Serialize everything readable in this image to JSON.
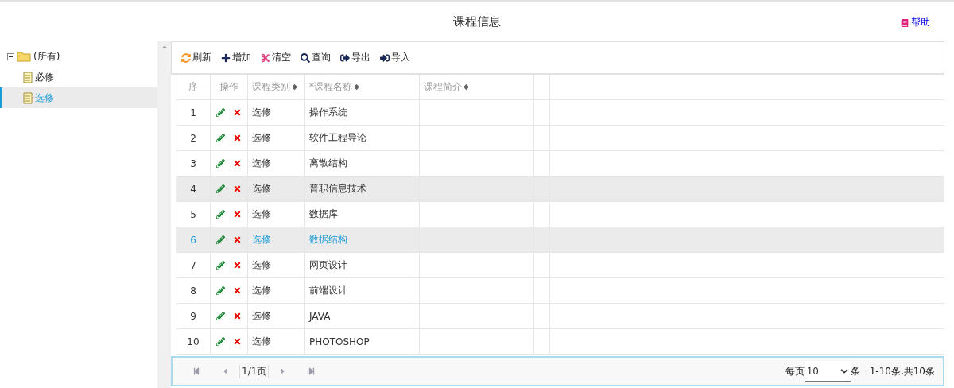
{
  "header": {
    "title": "课程信息",
    "help": "帮助"
  },
  "tree": [
    {
      "label": "(所有)",
      "kind": "folder",
      "expanded": true,
      "selected": false,
      "children": [
        {
          "label": "必修",
          "kind": "doc",
          "selected": false
        },
        {
          "label": "选修",
          "kind": "doc",
          "selected": true
        }
      ]
    }
  ],
  "toolbar": [
    {
      "label": "刷新"
    },
    {
      "label": "增加"
    },
    {
      "label": "清空"
    },
    {
      "label": "查询"
    },
    {
      "label": "导出"
    },
    {
      "label": "导入"
    }
  ],
  "table": {
    "columns": [
      {
        "label": "序",
        "sortable": false
      },
      {
        "label": "操作",
        "sortable": false
      },
      {
        "label": "课程类别",
        "sortable": true
      },
      {
        "label": "*课程名称",
        "sortable": true
      },
      {
        "label": "课程简介",
        "sortable": true
      }
    ],
    "rows": [
      {
        "index": "1",
        "category": "选修",
        "name": "操作系统",
        "hovered": false,
        "selected": false
      },
      {
        "index": "2",
        "category": "选修",
        "name": "软件工程导论",
        "hovered": false,
        "selected": false
      },
      {
        "index": "3",
        "category": "选修",
        "name": "离散结构",
        "hovered": false,
        "selected": false
      },
      {
        "index": "4",
        "category": "选修",
        "name": "普职信息技术",
        "hovered": true,
        "selected": false
      },
      {
        "index": "5",
        "category": "选修",
        "name": "数据库",
        "hovered": false,
        "selected": false
      },
      {
        "index": "6",
        "category": "选修",
        "name": "数据结构",
        "hovered": false,
        "selected": true
      },
      {
        "index": "7",
        "category": "选修",
        "name": "网页设计",
        "hovered": false,
        "selected": false
      },
      {
        "index": "8",
        "category": "选修",
        "name": "前端设计",
        "hovered": false,
        "selected": false
      },
      {
        "index": "9",
        "category": "选修",
        "name": "JAVA",
        "hovered": false,
        "selected": false
      },
      {
        "index": "10",
        "category": "选修",
        "name": "PHOTOSHOP",
        "hovered": false,
        "selected": false
      }
    ]
  },
  "pager": {
    "page": "1/1页",
    "per_page_label": "每页",
    "per_page": "10",
    "unit": "条",
    "summary": "1-10条,共10条"
  }
}
